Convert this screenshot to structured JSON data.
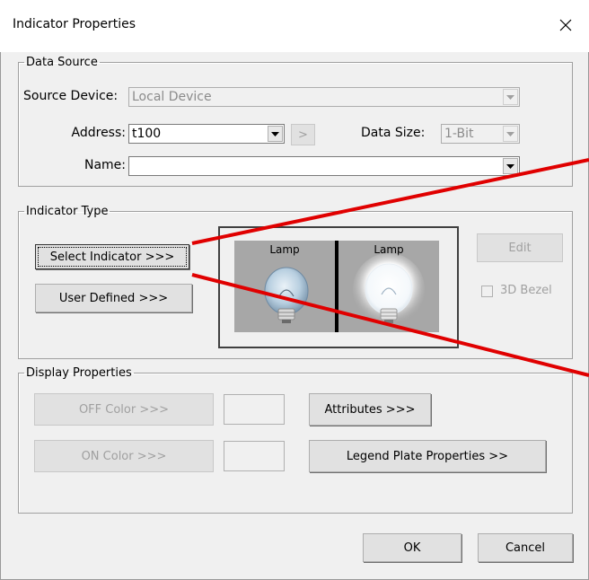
{
  "window": {
    "title": "Indicator Properties"
  },
  "data_source": {
    "legend": "Data Source",
    "source_device_label": "Source Device:",
    "source_device_value": "Local Device",
    "address_label": "Address:",
    "address_value": "t100",
    "address_browse_label": ">",
    "data_size_label": "Data Size:",
    "data_size_value": "1-Bit",
    "name_label": "Name:",
    "name_value": ""
  },
  "indicator_type": {
    "legend": "Indicator Type",
    "select_indicator_label": "Select Indicator >>>",
    "user_defined_label": "User Defined >>>",
    "edit_label": "Edit",
    "bezel_label": "3D Bezel",
    "bezel_checked": false,
    "preview": {
      "off_label": "Lamp",
      "on_label": "Lamp"
    }
  },
  "display_properties": {
    "legend": "Display Properties",
    "off_color_label": "OFF Color >>>",
    "on_color_label": "ON Color >>>",
    "attributes_label": "Attributes >>>",
    "legend_plate_label": "Legend Plate Properties >>"
  },
  "footer": {
    "ok_label": "OK",
    "cancel_label": "Cancel"
  },
  "colors": {
    "annotation_red": "#e00000",
    "lamp_panel_gray": "#a7a7a7"
  }
}
